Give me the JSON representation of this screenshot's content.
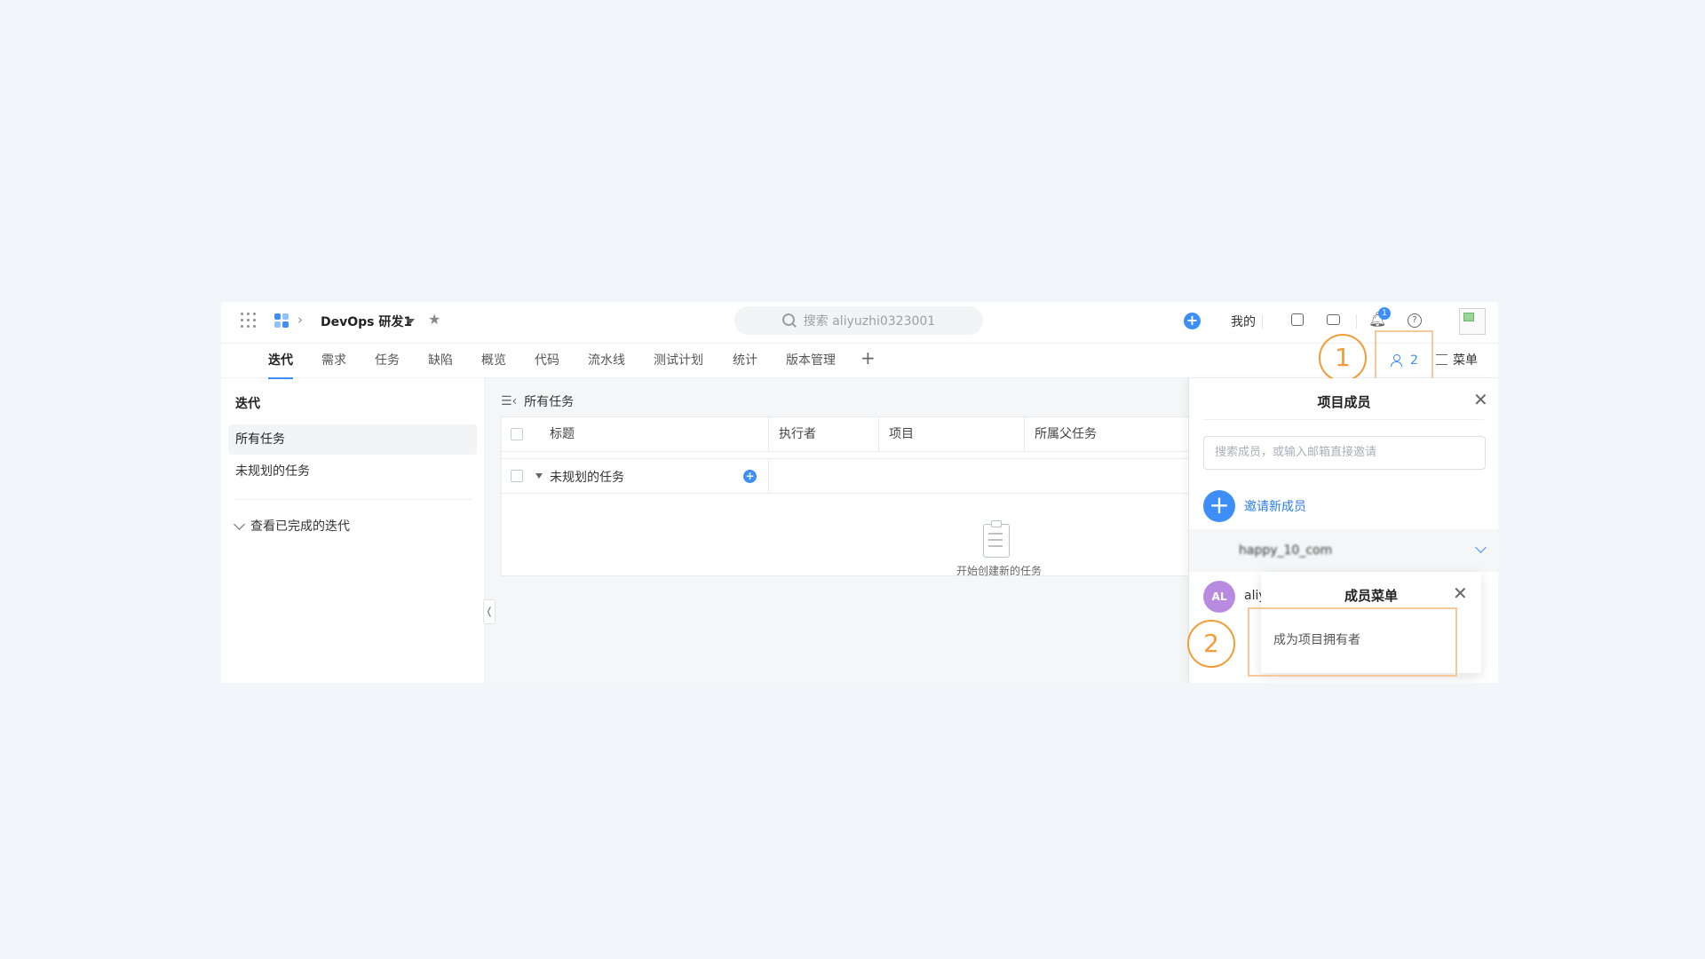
{
  "header": {
    "project_name": "DevOps 研发1",
    "search_placeholder": "搜索 aliyuzhi0323001",
    "mine_label": "我的",
    "notification_count": "1",
    "help_glyph": "?"
  },
  "nav": {
    "tabs": [
      "迭代",
      "需求",
      "任务",
      "缺陷",
      "概览",
      "代码",
      "流水线",
      "测试计划",
      "统计",
      "版本管理"
    ],
    "add": "+",
    "members_count": "2",
    "menu_label": "菜单"
  },
  "callouts": {
    "one": "1",
    "two": "2"
  },
  "sidebar": {
    "title": "迭代",
    "items": [
      "所有任务",
      "未规划的任务"
    ],
    "completed_label": "查看已完成的迭代"
  },
  "main": {
    "list_title": "所有任务",
    "columns": [
      "标题",
      "执行者",
      "项目",
      "所属父任务"
    ],
    "group_label": "未规划的任务",
    "empty_text": "开始创建新的任务",
    "collapse_glyph": "❬"
  },
  "members_panel": {
    "title": "项目成员",
    "search_placeholder": "搜索成员，或输入邮箱直接邀请",
    "invite_label": "邀请新成员",
    "group_name_blurred": "happy_10_com",
    "member_initials": "AL",
    "member_name": "aliy"
  },
  "member_menu": {
    "title": "成员菜单",
    "items": [
      "成为项目拥有者"
    ]
  },
  "colors": {
    "accent": "#3d8ef7",
    "callout": "#f39c38"
  }
}
